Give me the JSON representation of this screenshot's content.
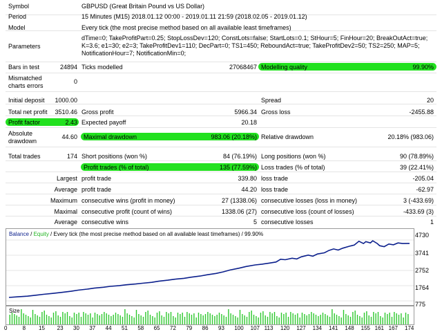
{
  "report": {
    "symbol_label": "Symbol",
    "symbol_value": "GBPUSD (Great Britain Pound vs US Dollar)",
    "period_label": "Period",
    "period_value": "15 Minutes (M15) 2018.01.12 00:00 - 2019.01.11 21:59 (2018.02.05 - 2019.01.12)",
    "model_label": "Model",
    "model_value": "Every tick (the most precise method based on all available least timeframes)",
    "parameters_label": "Parameters",
    "parameters_lines": [
      "dTime=0; TakeProfitPart=0.25; StopLossDev=120; ConstLots=false; StartLots=0.1; StHour=5; FinHour=20; BreakOutAct=true;",
      "K=3.6; e1=30; e2=3; TakeProfitDev1=110; DecPart=0; TS1=450; ReboundAct=true; TakeProfitDev2=50; TS2=250; MAP=5;",
      "NotificationHour=7; NotificationMin=0;"
    ],
    "bars_label": "Bars in test",
    "bars_value": "24894",
    "ticks_label": "Ticks modelled",
    "ticks_value": "27068467",
    "quality_label": "Modelling quality",
    "quality_value": "99.90%",
    "mismatched_label_1": "Mismatched",
    "mismatched_label_2": "charts errors",
    "mismatched_value": "0",
    "initial_deposit_label": "Initial deposit",
    "initial_deposit_value": "1000.00",
    "spread_label": "Spread",
    "spread_value": "20",
    "net_profit_label": "Total net profit",
    "net_profit_value": "3510.46",
    "gross_profit_label": "Gross profit",
    "gross_profit_value": "5966.34",
    "gross_loss_label": "Gross loss",
    "gross_loss_value": "-2455.88",
    "profit_factor_label": "Profit factor",
    "profit_factor_value": "2.43",
    "expected_payoff_label": "Expected payoff",
    "expected_payoff_value": "20.18",
    "abs_dd_label_1": "Absolute",
    "abs_dd_label_2": "drawdown",
    "abs_dd_value": "44.60",
    "max_dd_label": "Maximal drawdown",
    "max_dd_value": "983.06 (20.18%)",
    "rel_dd_label": "Relative drawdown",
    "rel_dd_value": "20.18% (983.06)",
    "total_trades_label": "Total trades",
    "total_trades_value": "174",
    "short_label": "Short positions (won %)",
    "short_value": "84 (76.19%)",
    "long_label": "Long positions (won %)",
    "long_value": "90 (78.89%)",
    "profit_trades_label": "Profit trades (% of total)",
    "profit_trades_value": "135 (77.59%)",
    "loss_trades_label": "Loss trades (% of total)",
    "loss_trades_value": "39 (22.41%)",
    "largest_label": "Largest",
    "largest_profit_label": "profit trade",
    "largest_profit_value": "339.80",
    "largest_loss_label": "loss trade",
    "largest_loss_value": "-205.04",
    "average_label": "Average",
    "average_profit_label": "profit trade",
    "average_profit_value": "44.20",
    "average_loss_label": "loss trade",
    "average_loss_value": "-62.97",
    "maximum_label": "Maximum",
    "max_cons_wins_label": "consecutive wins (profit in money)",
    "max_cons_wins_value": "27 (1338.06)",
    "max_cons_losses_label": "consecutive losses (loss in money)",
    "max_cons_losses_value": "3 (-433.69)",
    "maximal_label": "Maximal",
    "maximal_profit_label": "consecutive profit (count of wins)",
    "maximal_profit_value": "1338.06 (27)",
    "maximal_loss_label": "consecutive loss (count of losses)",
    "maximal_loss_value": "-433.69 (3)",
    "avg_cons_label": "Average",
    "avg_cons_wins_label": "consecutive wins",
    "avg_cons_wins_value": "5",
    "avg_cons_losses_label": "consecutive losses",
    "avg_cons_losses_value": "1"
  },
  "chart_header": {
    "balance": "Balance",
    "slash": " / ",
    "equity": "Equity",
    "rest": " / Every tick (the most precise method based on all available least timeframes) / 99.90%"
  },
  "size_label": "Size",
  "colors": {
    "balance_line": "#0b1f8c",
    "size_bars": "#2ec82e",
    "highlight": "#22e11f"
  },
  "chart_data": {
    "type": "line",
    "ylim": [
      775,
      4730
    ],
    "y_ticks": [
      "4730",
      "3741",
      "2752",
      "1764",
      "775"
    ],
    "x_ticks": [
      "0",
      "8",
      "15",
      "23",
      "30",
      "37",
      "44",
      "51",
      "58",
      "65",
      "72",
      "79",
      "86",
      "93",
      "100",
      "107",
      "113",
      "120",
      "127",
      "134",
      "141",
      "148",
      "155",
      "161",
      "167",
      "174"
    ],
    "xlim": [
      0,
      174
    ],
    "series": [
      {
        "values": [
          [
            0,
            1000
          ],
          [
            4,
            1040
          ],
          [
            8,
            1080
          ],
          [
            12,
            1150
          ],
          [
            15,
            1200
          ],
          [
            19,
            1260
          ],
          [
            23,
            1330
          ],
          [
            27,
            1400
          ],
          [
            30,
            1470
          ],
          [
            34,
            1540
          ],
          [
            37,
            1600
          ],
          [
            41,
            1660
          ],
          [
            44,
            1720
          ],
          [
            48,
            1770
          ],
          [
            51,
            1820
          ],
          [
            55,
            1870
          ],
          [
            58,
            1920
          ],
          [
            62,
            1980
          ],
          [
            65,
            2050
          ],
          [
            69,
            2120
          ],
          [
            72,
            2180
          ],
          [
            76,
            2240
          ],
          [
            79,
            2310
          ],
          [
            83,
            2390
          ],
          [
            86,
            2470
          ],
          [
            90,
            2560
          ],
          [
            93,
            2660
          ],
          [
            96,
            2780
          ],
          [
            100,
            2900
          ],
          [
            103,
            3010
          ],
          [
            107,
            3110
          ],
          [
            110,
            3160
          ],
          [
            113,
            3230
          ],
          [
            116,
            3300
          ],
          [
            118,
            3480
          ],
          [
            120,
            3450
          ],
          [
            123,
            3550
          ],
          [
            125,
            3500
          ],
          [
            127,
            3640
          ],
          [
            130,
            3750
          ],
          [
            132,
            3680
          ],
          [
            134,
            3820
          ],
          [
            137,
            3900
          ],
          [
            139,
            4050
          ],
          [
            141,
            4150
          ],
          [
            143,
            4080
          ],
          [
            145,
            4200
          ],
          [
            148,
            4330
          ],
          [
            150,
            4400
          ],
          [
            152,
            4650
          ],
          [
            154,
            4500
          ],
          [
            155,
            4620
          ],
          [
            157,
            4540
          ],
          [
            158,
            4680
          ],
          [
            160,
            4500
          ],
          [
            161,
            4360
          ],
          [
            163,
            4300
          ],
          [
            165,
            4470
          ],
          [
            167,
            4420
          ],
          [
            169,
            4540
          ],
          [
            171,
            4500
          ],
          [
            174,
            4510
          ]
        ]
      }
    ],
    "size_bars_count": 174
  }
}
